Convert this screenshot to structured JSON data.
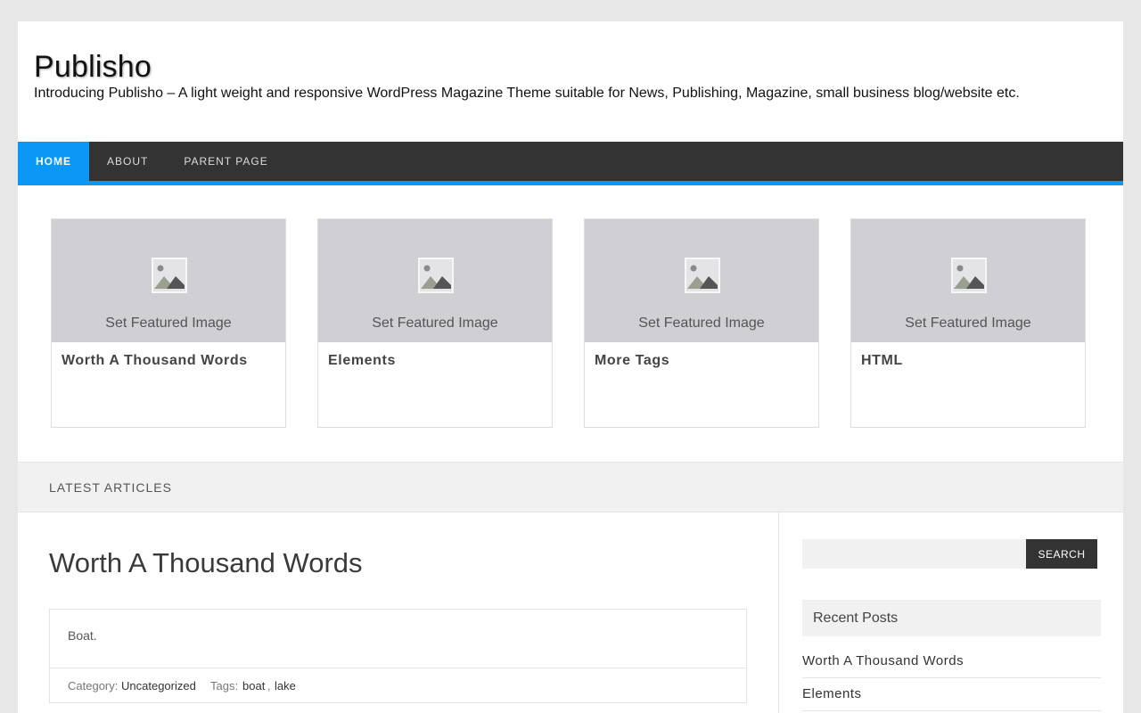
{
  "site": {
    "title": "Publisho",
    "description": "Introducing Publisho – A light weight and responsive WordPress Magazine Theme suitable for News, Publishing, Magazine, small business blog/website etc."
  },
  "nav": {
    "items": [
      {
        "label": "HOME",
        "active": true
      },
      {
        "label": "ABOUT",
        "active": false
      },
      {
        "label": "PARENT PAGE",
        "active": false
      }
    ],
    "accent_color": "#0a97f5",
    "bar_color": "#333333"
  },
  "featured": {
    "placeholder_text": "Set Featured Image",
    "placeholder_icon": "image-placeholder-icon",
    "cards": [
      {
        "title": "Worth A Thousand Words"
      },
      {
        "title": "Elements"
      },
      {
        "title": "More Tags"
      },
      {
        "title": "HTML"
      }
    ]
  },
  "latest": {
    "heading": "LATEST ARTICLES"
  },
  "post": {
    "title": "Worth A Thousand Words",
    "excerpt": "Boat.",
    "category_label": "Category:",
    "category": "Uncategorized",
    "tags_label": "Tags:",
    "tags": [
      "boat",
      "lake"
    ],
    "tag_separator": ","
  },
  "sidebar": {
    "search": {
      "placeholder": "",
      "button_label": "SEARCH"
    },
    "recent_posts": {
      "title": "Recent Posts",
      "items": [
        "Worth A Thousand Words",
        "Elements"
      ]
    }
  }
}
